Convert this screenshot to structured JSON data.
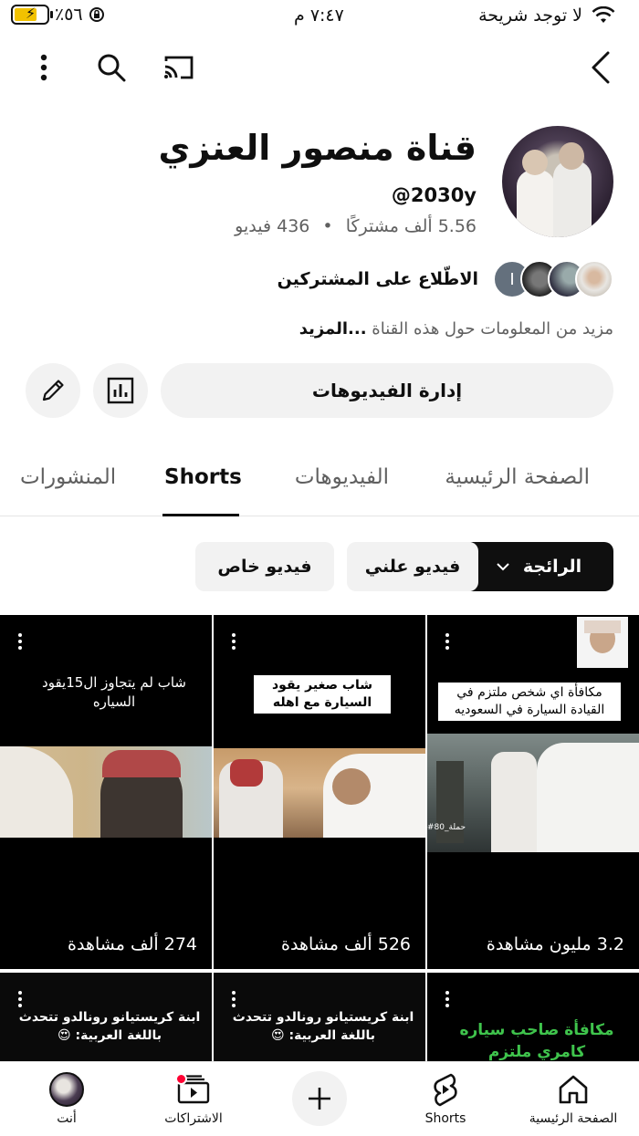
{
  "status_bar": {
    "carrier": "لا توجد شريحة",
    "time": "٧:٤٧ م",
    "battery": "٪٥٦"
  },
  "channel": {
    "name": "قناة منصور العنزي",
    "handle": "@2030y",
    "subscribers": "5.56 ألف مشتركًا",
    "separator": "•",
    "videos_count": "436 فيديو",
    "subscribers_link": "الاطّلاع على المشتركين",
    "subscriber_initial": "I",
    "more_info": "مزيد من المعلومات حول هذه القناة",
    "more_label": "...المزيد"
  },
  "actions": {
    "manage_videos": "إدارة الفيديوهات"
  },
  "tabs": [
    {
      "label": "الصفحة الرئيسية",
      "active": false
    },
    {
      "label": "الفيديوهات",
      "active": false
    },
    {
      "label": "Shorts",
      "active": true
    },
    {
      "label": "المنشورات",
      "active": false
    }
  ],
  "chips": {
    "sort": "الرائجة",
    "public": "فيديو علني",
    "private": "فيديو خاص"
  },
  "shorts": [
    {
      "caption": "مكافأة اي شخص ملتزم في القيادة السيارة في السعوديه",
      "views": "3.2 مليون مشاهدة",
      "watermark": "#حملة_80"
    },
    {
      "caption": "شاب صغير يقود السيارة مع اهله",
      "views": "526 ألف مشاهدة"
    },
    {
      "caption": "شاب لم يتجاوز ال15يقود السياره",
      "views": "274 ألف مشاهدة"
    },
    {
      "caption": "مكافأة صاحب سياره كامري ملتزم"
    },
    {
      "caption": "ابنة كريستيانو رونالدو تتحدث باللغة العربية: 😍"
    },
    {
      "caption": "ابنة كريستيانو رونالدو تتحدث باللغة العربية: 😍"
    }
  ],
  "bottom_nav": {
    "home": "الصفحة الرئيسية",
    "shorts": "Shorts",
    "subscriptions": "الاشتراكات",
    "you": "أنت"
  },
  "colors": {
    "text": "#0f0f0f",
    "secondary": "#606060",
    "chip_bg": "#f2f2f2",
    "notification_dot": "#ff0033"
  }
}
